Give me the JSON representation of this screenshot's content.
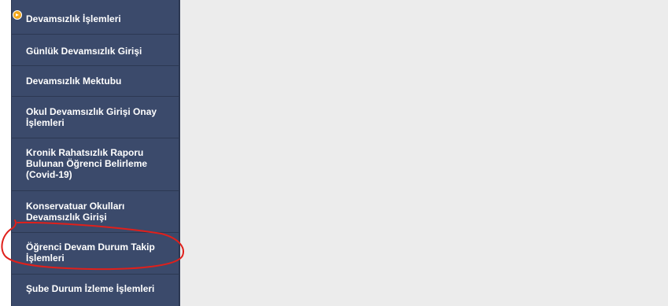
{
  "sidebar": {
    "header": {
      "label": "Devamsızlık İşlemleri",
      "icon": "arrow-circle-icon"
    },
    "items": [
      {
        "label": "Günlük Devamsızlık Girişi"
      },
      {
        "label": "Devamsızlık Mektubu"
      },
      {
        "label": "Okul Devamsızlık Girişi Onay İşlemleri"
      },
      {
        "label": "Kronik Rahatsızlık Raporu Bulunan Öğrenci Belirleme (Covid-19)"
      },
      {
        "label": "Konservatuar Okulları Devamsızlık Girişi"
      },
      {
        "label": "Öğrenci Devam Durum Takip İşlemleri"
      },
      {
        "label": "Şube Durum İzleme İşlemleri"
      }
    ]
  },
  "colors": {
    "sidebar_bg": "#3b4a6b",
    "content_bg": "#ececec",
    "accent": "#f2a81d",
    "annotation": "#e0201b"
  }
}
